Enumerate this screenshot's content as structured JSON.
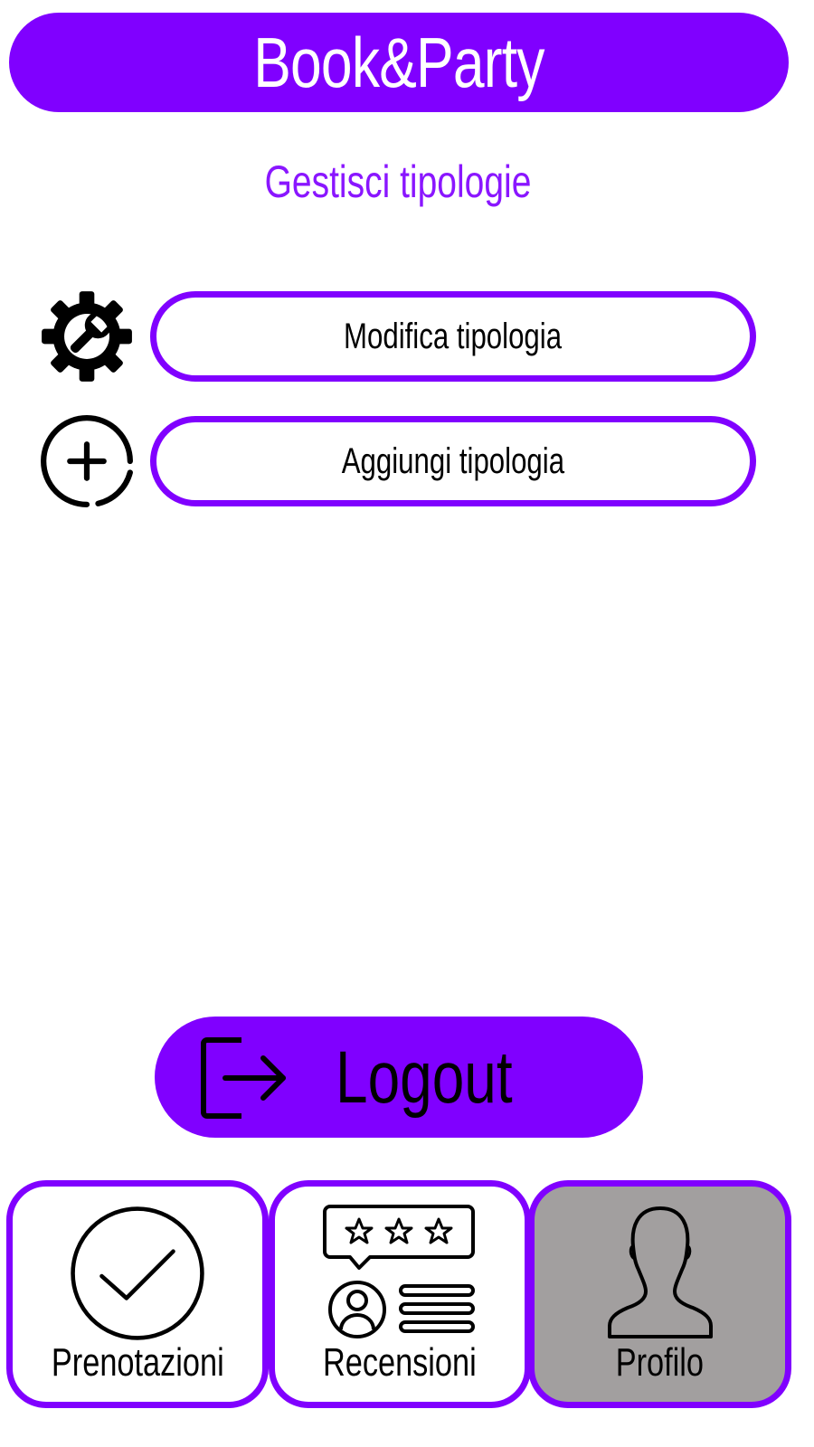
{
  "header": {
    "title": "Book&Party"
  },
  "page": {
    "title": "Gestisci tipologie"
  },
  "menu": [
    {
      "label": "Modifica tipologia",
      "icon": "gear-wrench-icon"
    },
    {
      "label": "Aggiungi tipologia",
      "icon": "plus-circle-icon"
    }
  ],
  "logout": {
    "label": "Logout",
    "icon": "logout-icon"
  },
  "nav": [
    {
      "label": "Prenotazioni",
      "icon": "check-circle-icon",
      "active": false
    },
    {
      "label": "Recensioni",
      "icon": "reviews-icon",
      "active": false
    },
    {
      "label": "Profilo",
      "icon": "user-silhouette-icon",
      "active": true
    }
  ],
  "colors": {
    "accent": "#8000ff",
    "title_text": "#8a16ff",
    "active_tab": "#a29f9f",
    "background": "#ffffff"
  }
}
